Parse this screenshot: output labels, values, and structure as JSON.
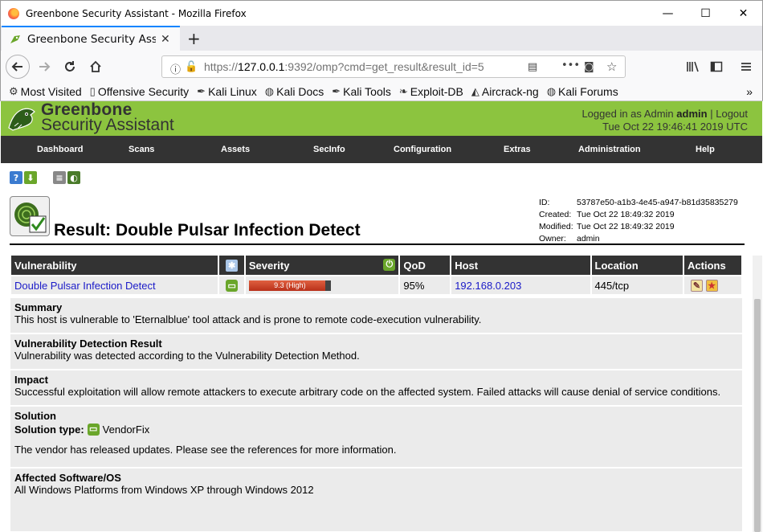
{
  "window": {
    "title": "Greenbone Security Assistant - Mozilla Firefox",
    "minimize_glyph": "—",
    "maximize_glyph": "☐",
    "close_glyph": "✕"
  },
  "tab": {
    "title": "Greenbone Security Assistant",
    "close_glyph": "✕",
    "new_tab_glyph": "+"
  },
  "url": {
    "prefix": "https://",
    "host": "127.0.0.1",
    "rest": ":9392/omp?cmd=get_result&result_id=5"
  },
  "bookmarks": [
    {
      "label": "Most Visited",
      "icon": "gear-icon",
      "glyph": "⚙"
    },
    {
      "label": "Offensive Security",
      "icon": "page-icon",
      "glyph": "▯"
    },
    {
      "label": "Kali Linux",
      "icon": "kali-icon",
      "glyph": "✒"
    },
    {
      "label": "Kali Docs",
      "icon": "globe-icon",
      "glyph": "◍"
    },
    {
      "label": "Kali Tools",
      "icon": "kali-icon",
      "glyph": "✒"
    },
    {
      "label": "Exploit-DB",
      "icon": "exploit-icon",
      "glyph": "❧"
    },
    {
      "label": "Aircrack-ng",
      "icon": "satellite-icon",
      "glyph": "◭"
    },
    {
      "label": "Kali Forums",
      "icon": "globe-icon",
      "glyph": "◍"
    }
  ],
  "gsa": {
    "logo_line1": "Greenbone",
    "logo_line2": "Security Assistant",
    "logged_in_prefix": "Logged in as",
    "role": "Admin",
    "user": "admin",
    "logout": "Logout",
    "datetime": "Tue Oct 22 19:46:41 2019 UTC"
  },
  "menu": [
    "Dashboard",
    "Scans",
    "Assets",
    "SecInfo",
    "Configuration",
    "Extras",
    "Administration",
    "Help"
  ],
  "title": "Result: Double Pulsar Infection Detect",
  "meta": {
    "id_label": "ID:",
    "id": "53787e50-a1b3-4e45-a947-b81d35835279",
    "created_label": "Created:",
    "created": "Tue Oct 22 18:49:32 2019",
    "modified_label": "Modified:",
    "modified": "Tue Oct 22 18:49:32 2019",
    "owner_label": "Owner:",
    "owner": "admin"
  },
  "table": {
    "headers": [
      "Vulnerability",
      "",
      "Severity",
      "QoD",
      "Host",
      "Location",
      "Actions"
    ],
    "row": {
      "vulnerability": "Double Pulsar Infection Detect",
      "severity_label": "9.3 (High)",
      "severity_value": 9.3,
      "severity_max": 10,
      "qod": "95%",
      "host": "192.168.0.203",
      "location": "445/tcp"
    }
  },
  "sections": {
    "summary_title": "Summary",
    "summary_text": "This host is vulnerable to 'Eternalblue' tool attack and is prone to remote code-execution vulnerability.",
    "detection_title": "Vulnerability Detection Result",
    "detection_text": "Vulnerability was detected according to the Vulnerability Detection Method.",
    "impact_title": "Impact",
    "impact_text": "Successful exploitation will allow remote attackers to execute arbitrary code on the affected system. Failed attacks will cause denial of service conditions.",
    "solution_title": "Solution",
    "solution_type_label": "Solution type:",
    "solution_type": "VendorFix",
    "solution_text": "The vendor has released updates. Please see the references for more information.",
    "affected_title": "Affected Software/OS",
    "affected_text": "All Windows Platforms from Windows XP through Windows 2012"
  },
  "colors": {
    "brand_green": "#8cc43f",
    "menu_dark": "#333333",
    "severity_high": "#c0391f",
    "link": "#1a1ac8"
  }
}
